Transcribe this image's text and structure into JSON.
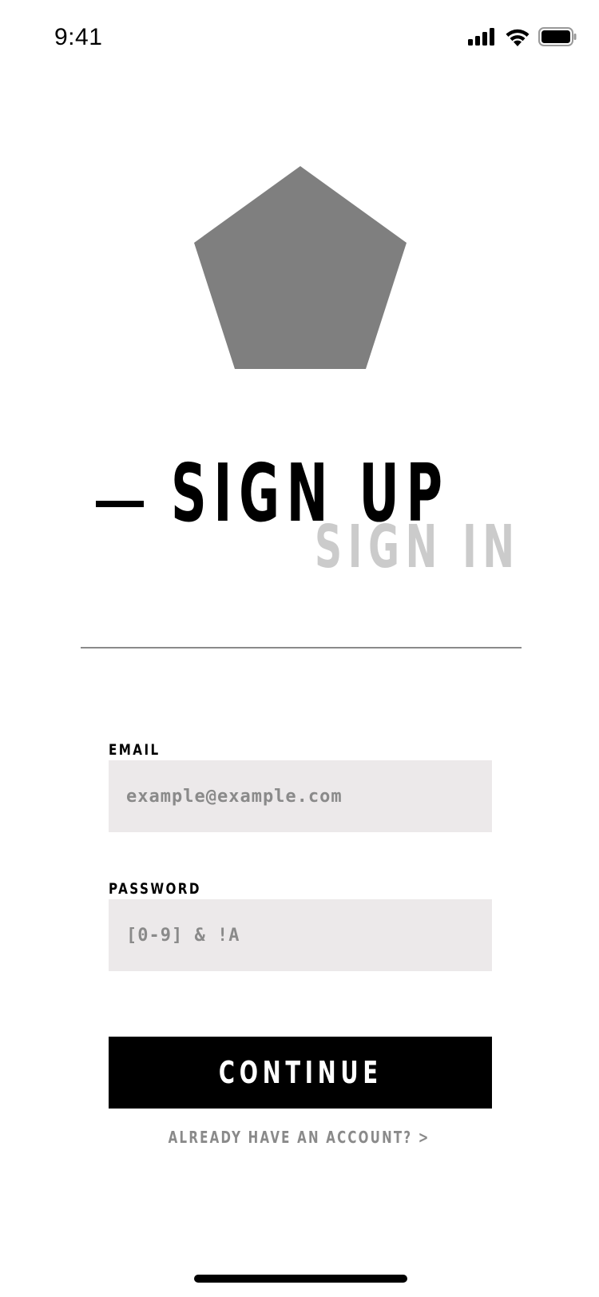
{
  "status_bar": {
    "time": "9:41",
    "icons": [
      "cellular-signal-icon",
      "wifi-icon",
      "battery-icon"
    ]
  },
  "logo": {
    "icon": "pentagon-logo",
    "color": "#7f7f7f"
  },
  "tabs": {
    "active": "SIGN UP",
    "inactive": "SIGN IN"
  },
  "form": {
    "email": {
      "label": "EMAIL",
      "placeholder": "example@example.com",
      "value": ""
    },
    "password": {
      "label": "PASSWORD",
      "placeholder": "[0-9] & !A",
      "value": ""
    },
    "submit_label": "CONTINUE"
  },
  "account_link": "ALREADY HAVE AN ACCOUNT? >",
  "colors": {
    "primary": "#000000",
    "input_background": "#ece9ea",
    "muted_text": "#8a8a8a",
    "inactive_tab": "#cbcbcb",
    "logo": "#7f7f7f"
  }
}
